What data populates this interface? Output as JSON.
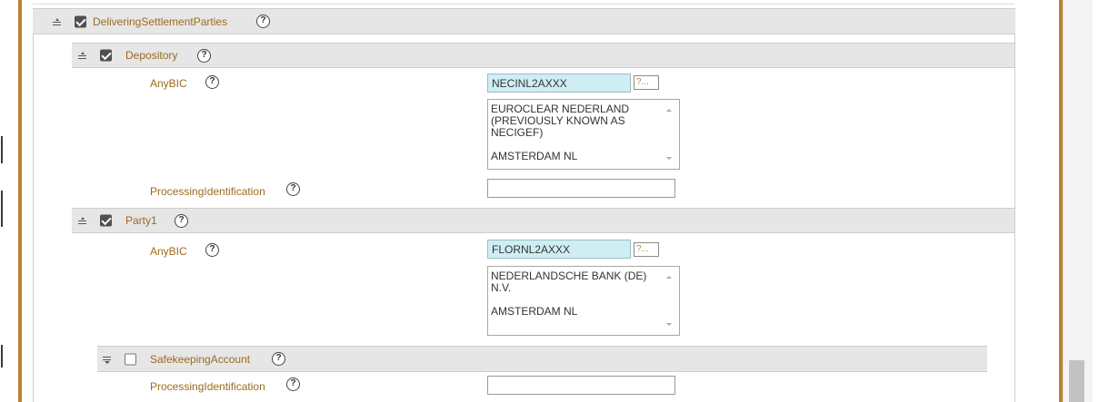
{
  "sections": {
    "delivering": {
      "label": "DeliveringSettlementParties",
      "checked": true
    },
    "depository": {
      "label": "Depository",
      "checked": true,
      "anybic_label": "AnyBIC",
      "anybic_value": "NECINL2AXXX",
      "lookup_label": "?...",
      "bic_details": "EUROCLEAR NEDERLAND\n(PREVIOUSLY KNOWN AS\nNECIGEF)\n\nAMSTERDAM NL",
      "processing_label": "ProcessingIdentification",
      "processing_value": ""
    },
    "party1": {
      "label": "Party1",
      "checked": true,
      "anybic_label": "AnyBIC",
      "anybic_value": "FLORNL2AXXX",
      "lookup_label": "?...",
      "bic_details": "NEDERLANDSCHE BANK (DE)\nN.V.\n\nAMSTERDAM NL"
    },
    "safekeeping": {
      "label": "SafekeepingAccount",
      "checked": false,
      "processing_label": "ProcessingIdentification",
      "processing_value": ""
    }
  },
  "help_glyph": "?",
  "colors": {
    "accent_border": "#b9832f",
    "label_text": "#9c6b1e",
    "header_bg": "#e6e6e6",
    "bic_input_bg": "#cfeef3"
  },
  "icons": [
    "collapse-icon",
    "expand-icon",
    "checkbox-checked-icon",
    "checkbox-unchecked-icon",
    "help-icon",
    "scroll-arrow-icon"
  ]
}
